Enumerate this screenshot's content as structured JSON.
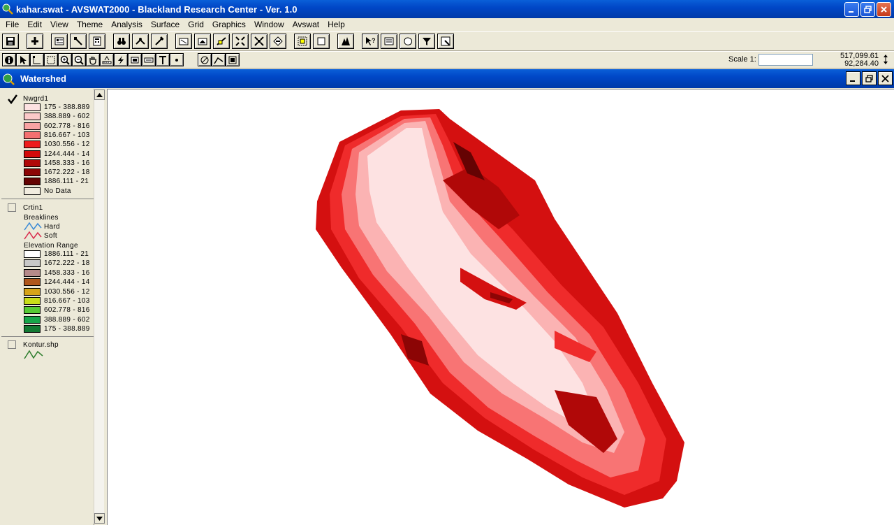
{
  "window": {
    "title": "kahar.swat - AVSWAT2000 - Blackland Research Center - Ver. 1.0"
  },
  "menu": [
    {
      "label": "File"
    },
    {
      "label": "Edit"
    },
    {
      "label": "View"
    },
    {
      "label": "Theme"
    },
    {
      "label": "Analysis"
    },
    {
      "label": "Surface"
    },
    {
      "label": "Grid"
    },
    {
      "label": "Graphics"
    },
    {
      "label": "Window"
    },
    {
      "label": "Avswat"
    },
    {
      "label": "Help"
    }
  ],
  "scale": {
    "label": "Scale 1:",
    "value": ""
  },
  "coords": {
    "x": "517,099.61",
    "y": "92,284.40"
  },
  "view": {
    "title": "Watershed"
  },
  "toc": {
    "theme1": {
      "name": "Nwgrd1",
      "checked": true,
      "classes": [
        {
          "label": "175 - 388.889",
          "color": "#fde2e2"
        },
        {
          "label": "388.889 - 602",
          "color": "#fbc9c9"
        },
        {
          "label": "602.778 - 816",
          "color": "#f8a3a3"
        },
        {
          "label": "816.667 - 103",
          "color": "#f47070"
        },
        {
          "label": "1030.556 - 12",
          "color": "#ee1d1d"
        },
        {
          "label": "1244.444 - 14",
          "color": "#d20a0a"
        },
        {
          "label": "1458.333 - 16",
          "color": "#b00808"
        },
        {
          "label": "1672.222 - 18",
          "color": "#8c0505"
        },
        {
          "label": "1886.111 - 21",
          "color": "#650303"
        },
        {
          "label": "No Data",
          "color": "#f1ecdf"
        }
      ]
    },
    "theme2": {
      "name": "Crtin1",
      "checked": false,
      "breaklines_label": "Breaklines",
      "hard_label": "Hard",
      "soft_label": "Soft",
      "elev_label": "Elevation Range",
      "classes": [
        {
          "label": "1886.111 - 21",
          "color": "#ffffff"
        },
        {
          "label": "1672.222 - 18",
          "color": "#c8c8c8"
        },
        {
          "label": "1458.333 - 16",
          "color": "#b58a8a"
        },
        {
          "label": "1244.444 - 14",
          "color": "#b0571c"
        },
        {
          "label": "1030.556 - 12",
          "color": "#d6a319"
        },
        {
          "label": "816.667 - 103",
          "color": "#c8dc1a"
        },
        {
          "label": "602.778 - 816",
          "color": "#55c935"
        },
        {
          "label": "388.889 - 602",
          "color": "#17a64a"
        },
        {
          "label": "175 - 388.889",
          "color": "#137a33"
        }
      ]
    },
    "theme3": {
      "name": "Kontur.shp",
      "checked": false
    }
  },
  "map": {
    "outline_colors": [
      "#d41010",
      "#ef2b2b",
      "#f87474",
      "#fbb3b3",
      "#fde2e2"
    ]
  }
}
